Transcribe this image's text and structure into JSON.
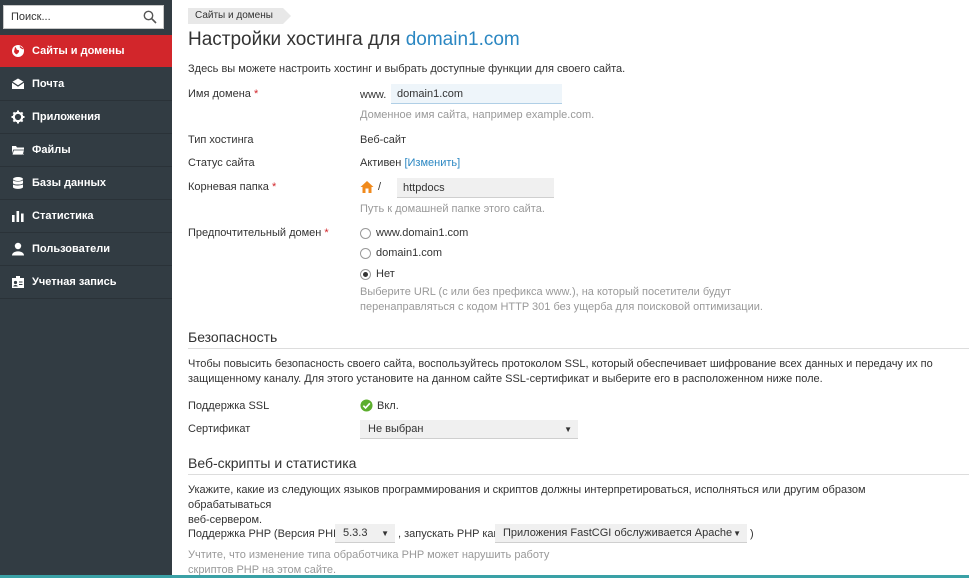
{
  "search": {
    "placeholder": "Поиск..."
  },
  "sidebar": {
    "items": [
      {
        "label": "Сайты и домены",
        "icon": "globe-icon",
        "active": true
      },
      {
        "label": "Почта",
        "icon": "mail-icon"
      },
      {
        "label": "Приложения",
        "icon": "gear-icon"
      },
      {
        "label": "Файлы",
        "icon": "folder-icon"
      },
      {
        "label": "Базы данных",
        "icon": "database-icon"
      },
      {
        "label": "Статистика",
        "icon": "bar-chart-icon"
      },
      {
        "label": "Пользователи",
        "icon": "user-icon"
      },
      {
        "label": "Учетная запись",
        "icon": "account-card-icon"
      }
    ]
  },
  "breadcrumb": "Сайты и домены",
  "title": {
    "prefix": "Настройки хостинга для ",
    "domain": "domain1.com"
  },
  "intro": "Здесь вы можете настроить хостинг и выбрать доступные функции для своего сайта.",
  "form": {
    "domain_label": "Имя домена",
    "required_mark": "*",
    "www_prefix": "www.",
    "domain_value": "domain1.com",
    "domain_hint": "Доменное имя сайта, например example.com.",
    "hosting_type_label": "Тип хостинга",
    "hosting_type_value": "Веб-сайт",
    "status_label": "Статус сайта",
    "status_value": "Активен",
    "status_change": "[Изменить]",
    "root_label": "Корневая папка",
    "root_slash": "/",
    "root_value": "httpdocs",
    "root_hint": "Путь к домашней папке этого сайта.",
    "preferred_label": "Предпочтительный домен",
    "preferred_options": [
      "www.domain1.com",
      "domain1.com",
      "Нет"
    ],
    "preferred_selected": 2,
    "preferred_hint_1": "Выберите URL (с или без префикса www.), на который посетители будут",
    "preferred_hint_2": "перенаправляться с кодом HTTP 301 без ущерба для поисковой оптимизации."
  },
  "security": {
    "heading": "Безопасность",
    "text_1": "Чтобы повысить безопасность своего сайта, воспользуйтесь протоколом SSL, который обеспечивает шифрование всех данных и передачу их по",
    "text_2": "защищенному каналу. Для этого установите на данном сайте SSL-сертификат и выберите его в расположенном ниже поле.",
    "ssl_label": "Поддержка SSL",
    "ssl_value": "Вкл.",
    "cert_label": "Сертификат",
    "cert_value": "Не выбран"
  },
  "scripts": {
    "heading": "Веб-скрипты и статистика",
    "text_1": "Укажите, какие из следующих языков программирования и скриптов должны интерпретироваться, исполняться или другим образом обрабатываться",
    "text_2": "веб-сервером.",
    "php_label_1": "Поддержка PHP (Версия PHP",
    "php_version": "5.3.3",
    "php_label_2": ", запускать PHP как",
    "php_handler": "Приложения FastCGI обслуживается Apache",
    "php_close": ")",
    "php_hint_1": "Учтите, что изменение типа обработчика PHP может нарушить работу",
    "php_hint_2": "скриптов PHP на этом сайте."
  }
}
